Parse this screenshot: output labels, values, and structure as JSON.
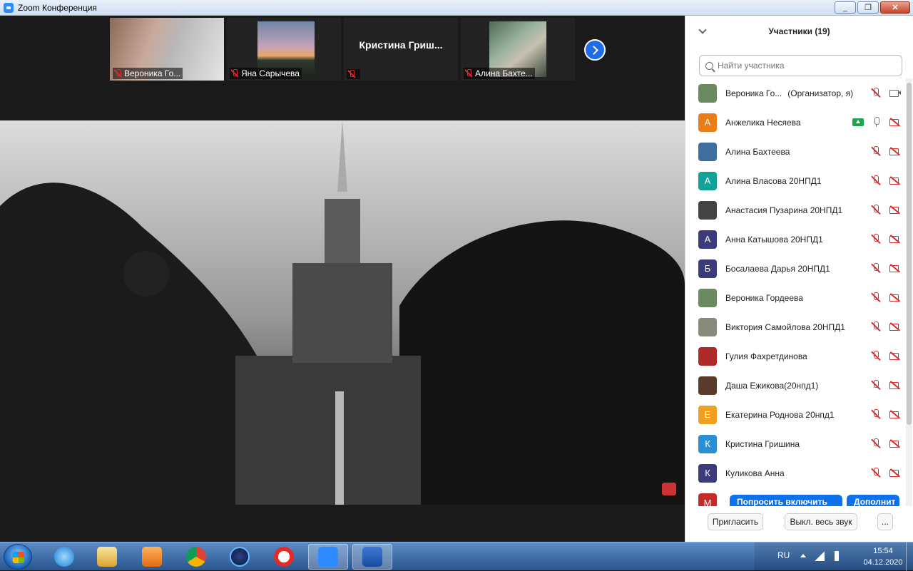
{
  "window": {
    "title": "Zoom Конференция"
  },
  "thumbnails": [
    {
      "name": "Вероника Го...",
      "muted": true
    },
    {
      "name": "Яна Сарычева",
      "muted": true
    },
    {
      "name": "",
      "big_name": "Кристина Гриш...",
      "muted": true
    },
    {
      "name": "Алина Бахте...",
      "muted": true
    }
  ],
  "panel": {
    "title": "Участники (19)",
    "search_placeholder": "Найти участника",
    "participants": [
      {
        "initial": "",
        "name": "Вероника Го...",
        "role": "(Организатор, я)",
        "avatar_color": "#6b8a5f",
        "mic": "off",
        "video": "on"
      },
      {
        "initial": "А",
        "name": "Анжелика Несяева",
        "role": "",
        "avatar_color": "#e87e17",
        "mic": "on",
        "video": "off",
        "sharing": true
      },
      {
        "initial": "",
        "name": "Алина Бахтеева",
        "role": "",
        "avatar_color": "#3f6fa0",
        "mic": "off",
        "video": "off"
      },
      {
        "initial": "А",
        "name": "Алина Власова 20НПД1",
        "role": "",
        "avatar_color": "#12a398",
        "mic": "off",
        "video": "off"
      },
      {
        "initial": "",
        "name": "Анастасия Пузарина 20НПД1",
        "role": "",
        "avatar_color": "#444444",
        "mic": "off",
        "video": "off"
      },
      {
        "initial": "А",
        "name": "Анна Катышова 20НПД1",
        "role": "",
        "avatar_color": "#3b3b7a",
        "mic": "off",
        "video": "off"
      },
      {
        "initial": "Б",
        "name": "Босалаева Дарья 20НПД1",
        "role": "",
        "avatar_color": "#3b3b7a",
        "mic": "off",
        "video": "off"
      },
      {
        "initial": "",
        "name": "Вероника Гордеева",
        "role": "",
        "avatar_color": "#6b8a5f",
        "mic": "off",
        "video": "off"
      },
      {
        "initial": "",
        "name": "Виктория Самойлова 20НПД1",
        "role": "",
        "avatar_color": "#8a8a7a",
        "mic": "off",
        "video": "off"
      },
      {
        "initial": "",
        "name": "Гулия Фахретдинова",
        "role": "",
        "avatar_color": "#b02a2a",
        "mic": "off",
        "video": "off"
      },
      {
        "initial": "",
        "name": "Даша Ежикова(20нпд1)",
        "role": "",
        "avatar_color": "#5a3b2a",
        "mic": "off",
        "video": "off"
      },
      {
        "initial": "Е",
        "name": "Екатерина Роднова 20нпд1",
        "role": "",
        "avatar_color": "#f0a020",
        "mic": "off",
        "video": "off"
      },
      {
        "initial": "К",
        "name": "Кристина Гришина",
        "role": "",
        "avatar_color": "#2b8fd6",
        "mic": "off",
        "video": "off"
      },
      {
        "initial": "К",
        "name": "Куликова Анна",
        "role": "",
        "avatar_color": "#3b3b7a",
        "mic": "off",
        "video": "off"
      }
    ],
    "partial_row": {
      "initial": "М",
      "ask_unmute": "Попросить включить",
      "more": "Дополнит"
    },
    "footer": {
      "invite": "Пригласить",
      "mute_all": "Выкл. весь звук",
      "more": "..."
    }
  },
  "tray": {
    "lang": "RU",
    "time": "15:54",
    "date": "04.12.2020"
  }
}
